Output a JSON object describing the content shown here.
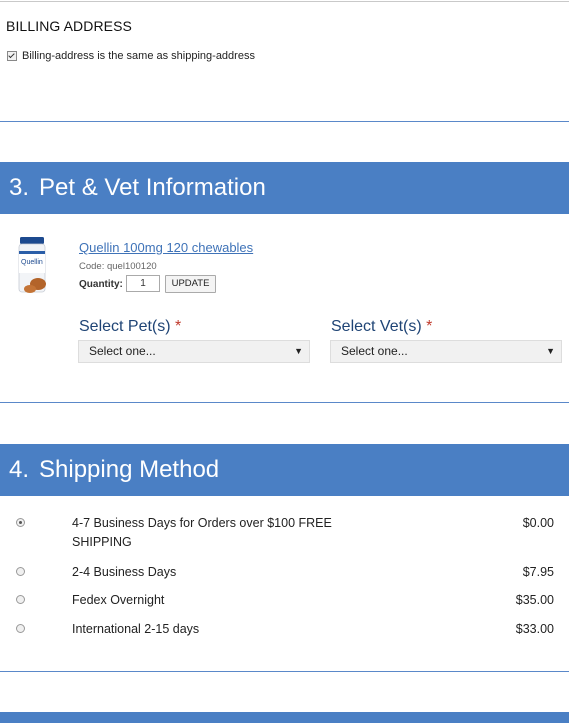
{
  "billing": {
    "title": "BILLING ADDRESS",
    "same_as_shipping_label": "Billing-address is the same as shipping-address"
  },
  "pet_vet": {
    "number": "3.",
    "title": "Pet & Vet Information",
    "product": {
      "name": "Quellin 100mg 120 chewables",
      "code": "Code: quel100120",
      "quantity_label": "Quantity:",
      "quantity_value": "1",
      "update_label": "UPDATE",
      "image_brand": "Quellin"
    },
    "select_pet_label": "Select Pet(s)",
    "select_vet_label": "Select Vet(s)",
    "required_mark": "*",
    "select_placeholder": "Select one...",
    "dropdown_arrow": "▼"
  },
  "shipping": {
    "number": "4.",
    "title": "Shipping Method",
    "options": [
      {
        "label": "4-7 Business Days for Orders over $100 FREE SHIPPING",
        "price": "$0.00",
        "selected": true
      },
      {
        "label": "2-4 Business Days",
        "price": "$7.95",
        "selected": false
      },
      {
        "label": "Fedex Overnight",
        "price": "$35.00",
        "selected": false
      },
      {
        "label": "International 2-15 days",
        "price": "$33.00",
        "selected": false
      }
    ]
  },
  "colors": {
    "header_bg": "#4a7fc4",
    "link": "#3f73b8",
    "select_label": "#1f4475",
    "required": "#c0392b"
  }
}
